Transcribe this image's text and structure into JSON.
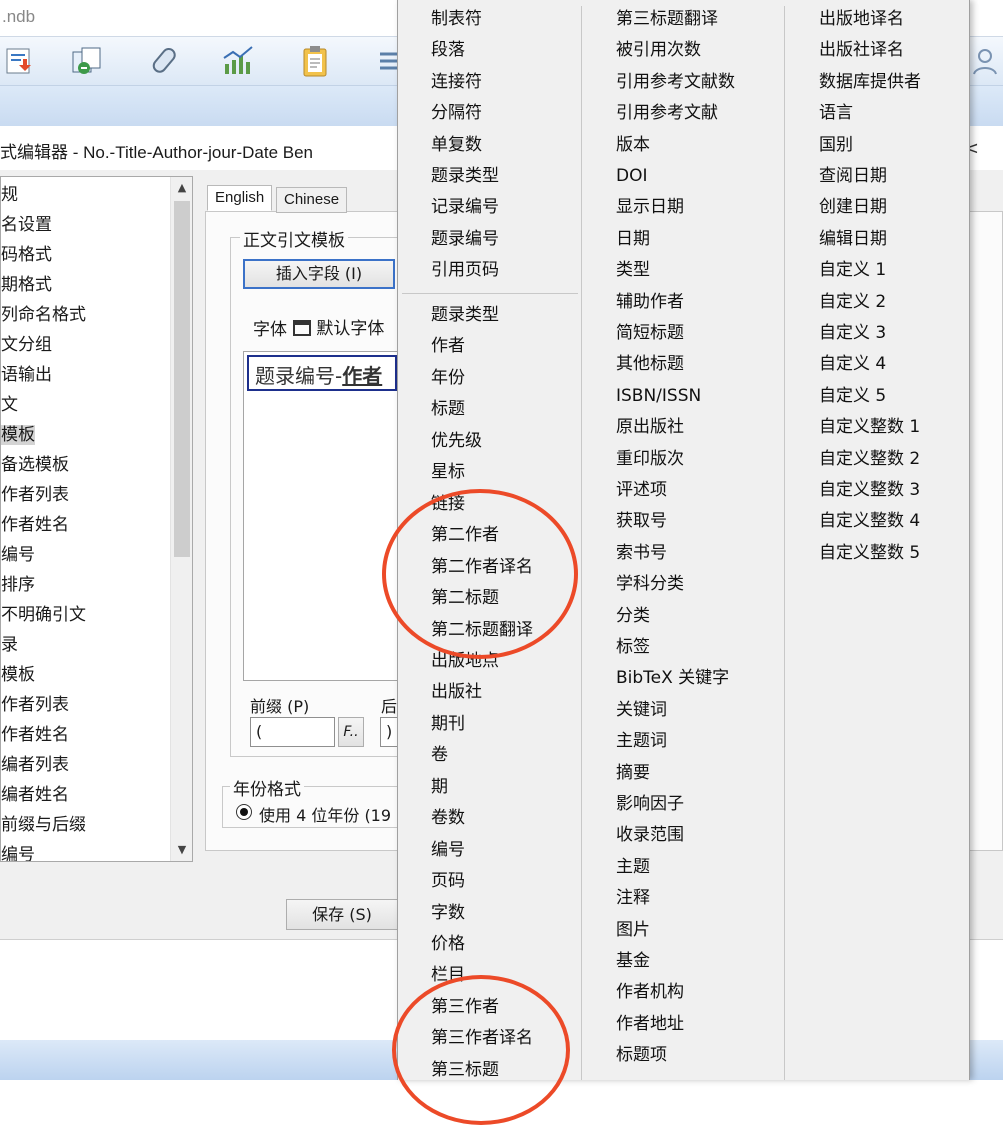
{
  "window": {
    "title": ".ndb"
  },
  "toolbar": {
    "icons": [
      "import-icon",
      "copy-icon",
      "attach-icon",
      "chart-icon",
      "clipboard-icon",
      "list-icon",
      "user-icon"
    ]
  },
  "editor": {
    "title": "式编辑器 - No.-Title-Author-jour-Date Ben",
    "close_glyph": "<"
  },
  "tree": {
    "items": [
      {
        "label": "规"
      },
      {
        "label": "名设置"
      },
      {
        "label": "码格式"
      },
      {
        "label": "期格式"
      },
      {
        "label": "列命名格式"
      },
      {
        "label": "文分组"
      },
      {
        "label": "语输出"
      },
      {
        "label": "文"
      },
      {
        "label": "模板"
      },
      {
        "label": "备选模板"
      },
      {
        "label": "作者列表"
      },
      {
        "label": "作者姓名"
      },
      {
        "label": "编号"
      },
      {
        "label": "排序"
      },
      {
        "label": "不明确引文"
      },
      {
        "label": "录"
      },
      {
        "label": "模板"
      },
      {
        "label": "作者列表"
      },
      {
        "label": "作者姓名"
      },
      {
        "label": "编者列表"
      },
      {
        "label": "编者姓名"
      },
      {
        "label": "前缀与后缀"
      },
      {
        "label": "编号"
      }
    ],
    "selected_index": 8
  },
  "tabs": [
    {
      "label": "English",
      "active": true
    },
    {
      "label": "Chinese",
      "active": false
    }
  ],
  "template_group": {
    "title": "正文引文模板",
    "insert_field_button": "插入字段 (I)",
    "font_label": "字体",
    "font_value": "默认字体",
    "template_text_normal": "题录编号-",
    "template_text_bold": "作者"
  },
  "affix": {
    "prefix_label": "前缀 (P)",
    "suffix_label": "后",
    "prefix_value": "(",
    "suffix_value": ")",
    "format_button": "F.."
  },
  "year_group": {
    "title": "年份格式",
    "option_label": "使用 4 位年份 (19"
  },
  "save_button": "保存 (S)",
  "menu": {
    "col1_top": [
      "制表符",
      "段落",
      "连接符",
      "分隔符",
      "单复数",
      "题录类型",
      "记录编号",
      "题录编号",
      "引用页码"
    ],
    "col1_bottom": [
      "题录类型",
      "作者",
      "年份",
      "标题",
      "优先级",
      "星标",
      "链接",
      "第二作者",
      "第二作者译名",
      "第二标题",
      "第二标题翻译",
      "出版地点",
      "出版社",
      "期刊",
      "卷",
      "期",
      "卷数",
      "编号",
      "页码",
      "字数",
      "价格",
      "栏目",
      "第三作者",
      "第三作者译名",
      "第三标题"
    ],
    "col2": [
      "第三标题翻译",
      "被引用次数",
      "引用参考文献数",
      "引用参考文献",
      "版本",
      "DOI",
      "显示日期",
      "日期",
      "类型",
      "辅助作者",
      "简短标题",
      "其他标题",
      "ISBN/ISSN",
      "原出版社",
      "重印版次",
      "评述项",
      "获取号",
      "索书号",
      "学科分类",
      "分类",
      "标签",
      "BibTeX 关键字",
      "关键词",
      "主题词",
      "摘要",
      "影响因子",
      "收录范围",
      "主题",
      "注释",
      "图片",
      "基金",
      "作者机构",
      "作者地址",
      "标题项"
    ],
    "col3": [
      "出版地译名",
      "出版社译名",
      "数据库提供者",
      "语言",
      "国别",
      "查阅日期",
      "创建日期",
      "编辑日期",
      "自定义 1",
      "自定义 2",
      "自定义 3",
      "自定义 4",
      "自定义 5",
      "自定义整数 1",
      "自定义整数 2",
      "自定义整数 3",
      "自定义整数 4",
      "自定义整数 5"
    ]
  },
  "colors": {
    "annotation_circle": "#ec4a28",
    "selection_border": "#1d2f8c"
  }
}
